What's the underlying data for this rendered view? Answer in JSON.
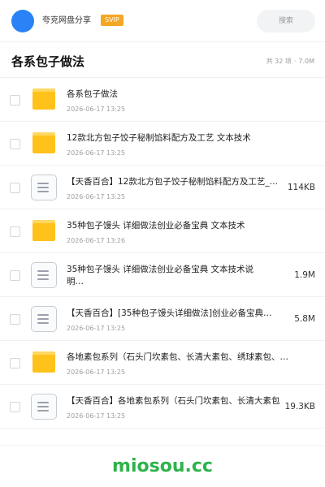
{
  "header": {
    "app_name": "夸克网盘分享",
    "badge": "SVIP",
    "search_placeholder": "搜索"
  },
  "folder": {
    "title": "各系包子做法",
    "count": "共 32 项",
    "size": "7.0M"
  },
  "items": [
    {
      "type": "folder",
      "name": "各系包子做法",
      "date": "2026-06-17 13:25",
      "size": ""
    },
    {
      "type": "folder",
      "name": "12款北方包子饺子秘制馅料配方及工艺 文本技术",
      "date": "2026-06-17 13:25",
      "size": ""
    },
    {
      "type": "file",
      "name": "【天香百合】12款北方包子饺子秘制馅料配方及工艺_…",
      "date": "2026-06-17 13:25",
      "size": "114KB"
    },
    {
      "type": "folder",
      "name": "35种包子馒头 详细做法创业必备宝典 文本技术",
      "date": "2026-06-17 13:26",
      "size": ""
    },
    {
      "type": "file",
      "name": "35种包子馒头 详细做法创业必备宝典 文本技术说明…",
      "date": "",
      "size": "1.9M"
    },
    {
      "type": "file",
      "name": "【天香百合】[35种包子馒头详细做法]创业必备宝典…",
      "date": "2026-06-17 13:25",
      "size": "5.8M"
    },
    {
      "type": "folder",
      "name": "各地素包系列（石头门坎素包、长清大素包、绣球素包、…",
      "date": "2026-06-17 13:25",
      "size": ""
    },
    {
      "type": "file",
      "name": "【天香百合】各地素包系列（石头门坎素包、长清大素包",
      "date": "2026-06-17 13:25",
      "size": "19.3KB"
    }
  ],
  "footer": {
    "brand": "miosou.cc"
  },
  "colors": {
    "avatar": "#2a82f6",
    "badge": "#f5a623",
    "folder": "#ffc21a",
    "brand": "#2db34a"
  }
}
